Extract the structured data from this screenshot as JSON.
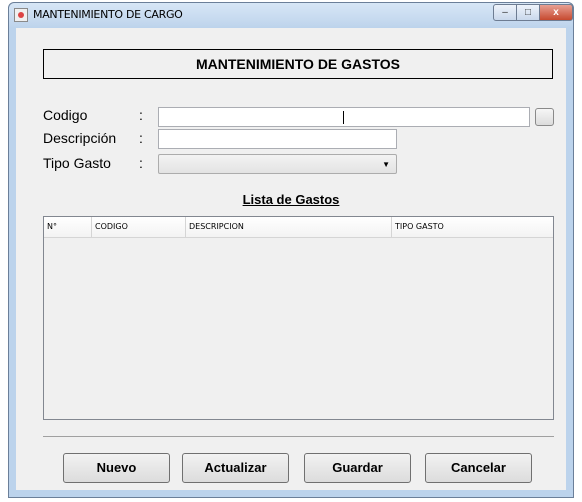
{
  "window": {
    "title": "MANTENIMIENTO DE CARGO",
    "close_glyph": "x",
    "min_glyph": "–",
    "max_glyph": "□"
  },
  "header": {
    "title": "MANTENIMIENTO DE GASTOS"
  },
  "form": {
    "colon": ":",
    "codigo": {
      "label": "Codigo",
      "value": ""
    },
    "descripcion": {
      "label": "Descripción",
      "value": ""
    },
    "tipo_gasto": {
      "label": "Tipo Gasto",
      "selected": ""
    }
  },
  "list": {
    "title": "Lista de Gastos",
    "columns": [
      "N°",
      "CODIGO",
      "DESCRIPCION",
      "TIPO GASTO"
    ],
    "rows": []
  },
  "buttons": {
    "nuevo": "Nuevo",
    "actualizar": "Actualizar",
    "guardar": "Guardar",
    "cancelar": "Cancelar"
  },
  "icons": {
    "app": "java-cup-icon",
    "lookup": "search-button-icon",
    "dropdown": "chevron-down-icon"
  }
}
